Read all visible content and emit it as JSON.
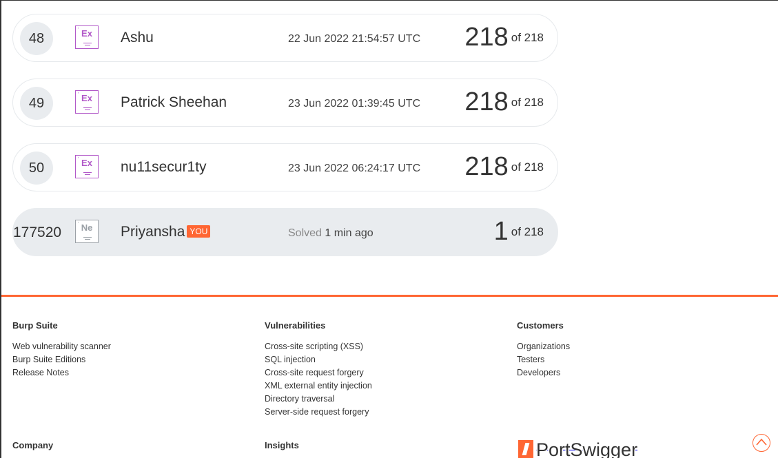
{
  "leaderboard": {
    "rows": [
      {
        "rank": "48",
        "level": "Ex",
        "name": "Ashu",
        "time": "22 Jun 2022 21:54:57 UTC",
        "score": "218",
        "of": "of 218"
      },
      {
        "rank": "49",
        "level": "Ex",
        "name": "Patrick Sheehan",
        "time": "23 Jun 2022 01:39:45 UTC",
        "score": "218",
        "of": "of 218"
      },
      {
        "rank": "50",
        "level": "Ex",
        "name": "nu11secur1ty",
        "time": "23 Jun 2022 06:24:17 UTC",
        "score": "218",
        "of": "of 218"
      }
    ],
    "me": {
      "rank": "177520",
      "level": "Ne",
      "name": "Priyansha",
      "badge": "YOU",
      "solved_label": "Solved",
      "solved_time": "1 min ago",
      "score": "1",
      "of": "of 218"
    }
  },
  "footer": {
    "columns": [
      {
        "heading": "Burp Suite",
        "links": [
          "Web vulnerability scanner",
          "Burp Suite Editions",
          "Release Notes"
        ]
      },
      {
        "heading": "Vulnerabilities",
        "links": [
          "Cross-site scripting (XSS)",
          "SQL injection",
          "Cross-site request forgery",
          "XML external entity injection",
          "Directory traversal",
          "Server-side request forgery"
        ]
      },
      {
        "heading": "Customers",
        "links": [
          "Organizations",
          "Testers",
          "Developers"
        ]
      }
    ],
    "second_row": {
      "company": "Company",
      "insights": "Insights"
    },
    "logo_text": "PortSwigger",
    "logo_icon": "portswigger-logo-icon",
    "scroll_top_icon": "chevron-up-icon"
  },
  "colors": {
    "accent": "#ff6633",
    "expert": "#b158c8",
    "row_bg": "#e9ecef"
  }
}
